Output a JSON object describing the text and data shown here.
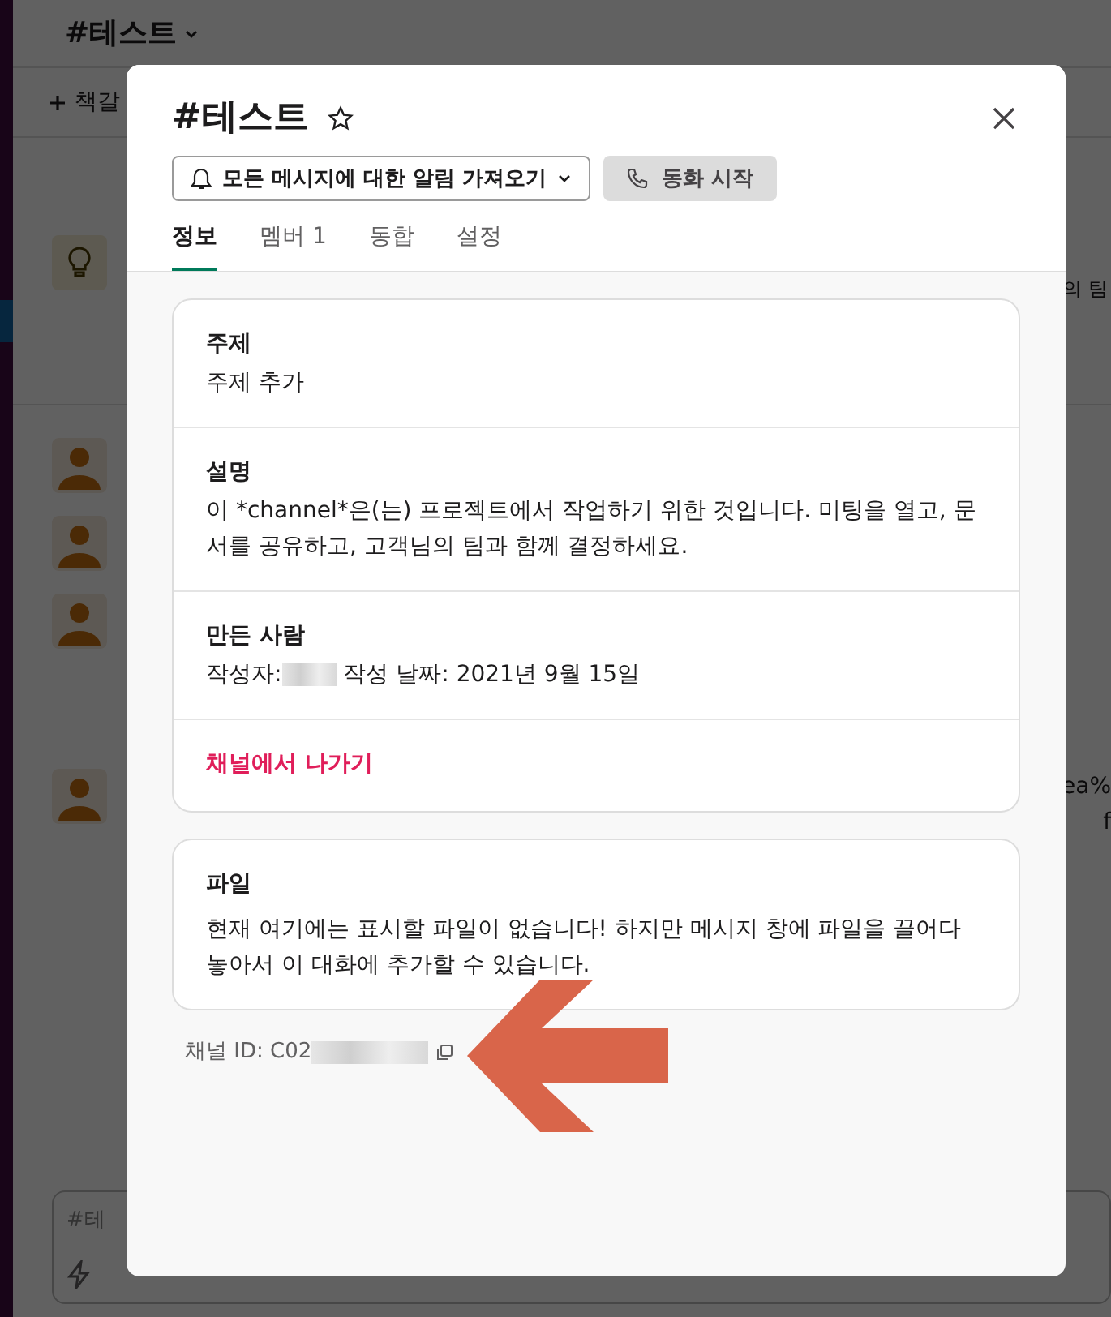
{
  "background": {
    "channel_header": "#테스트",
    "bookmark": "책갈",
    "intro_fragment": "의 팀",
    "message_fragments": [
      "ea%",
      "f"
    ],
    "composer": {
      "placeholder": "#테"
    }
  },
  "dialog": {
    "title": "#테스트",
    "starred": false,
    "notify_button": "모든 메시지에 대한 알림 가져오기",
    "call_button": "동화 시작",
    "tabs": [
      {
        "label": "정보",
        "selected": true
      },
      {
        "label": "멤버 1",
        "selected": false
      },
      {
        "label": "동합",
        "selected": false
      },
      {
        "label": "설정",
        "selected": false
      }
    ],
    "about": [
      {
        "kind": "field",
        "heading": "주제",
        "value": "주제 추가"
      },
      {
        "kind": "field",
        "heading": "설명",
        "value": "이 *channel*은(는) 프로젝트에서 작업하기 위한 것입니다. 미팅을 열고, 문서를 공유하고, 고객님의 팀과 함께 결정하세요."
      },
      {
        "kind": "creator",
        "heading": "만든 사람",
        "prefix": "작성자:",
        "date": "작성 날짜: 2021년 9월 15일"
      },
      {
        "kind": "leave",
        "label": "채널에서 나가기"
      }
    ],
    "files": {
      "heading": "파일",
      "text": "현재 여기에는 표시할 파일이 없습니다! 하지만 메시지 창에 파일을 끌어다 놓아서 이 대화에 추가할 수 있습니다."
    },
    "channel_id": "채널 ID: C02"
  }
}
